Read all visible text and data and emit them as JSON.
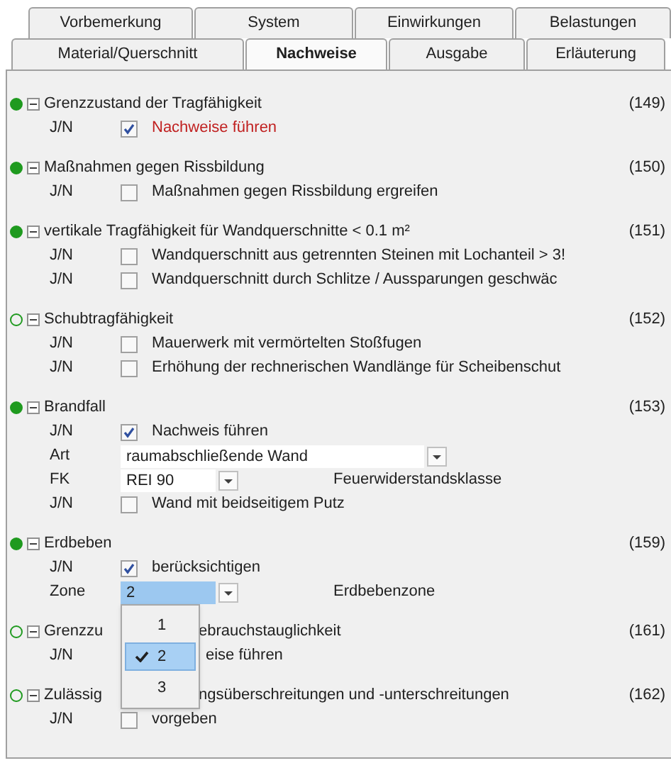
{
  "tabs_top": [
    {
      "label": "Vorbemerkung",
      "selected": false
    },
    {
      "label": "System",
      "selected": false
    },
    {
      "label": "Einwirkungen",
      "selected": false
    },
    {
      "label": "Belastungen",
      "selected": false
    }
  ],
  "tabs_bottom": [
    {
      "label": "Material/Querschnitt",
      "selected": false
    },
    {
      "label": "Nachweise",
      "selected": true
    },
    {
      "label": "Ausgabe",
      "selected": false
    },
    {
      "label": "Erläuterung",
      "selected": false
    }
  ],
  "sections": [
    {
      "title": "Grenzzustand der Tragfähigkeit",
      "number": "(149)",
      "filled": true,
      "expanded": true,
      "rows": [
        {
          "kind": "check",
          "label": "J/N",
          "checked": true,
          "text": "Nachweise führen",
          "emphasized": true
        }
      ]
    },
    {
      "title": "Maßnahmen gegen Rissbildung",
      "number": "(150)",
      "filled": true,
      "expanded": true,
      "rows": [
        {
          "kind": "check",
          "label": "J/N",
          "checked": false,
          "text": "Maßnahmen gegen Rissbildung ergreifen",
          "emphasized": false
        }
      ]
    },
    {
      "title": "vertikale Tragfähigkeit für Wandquerschnitte < 0.1 m²",
      "number": "(151)",
      "filled": true,
      "expanded": true,
      "rows": [
        {
          "kind": "check",
          "label": "J/N",
          "checked": false,
          "text": "Wandquerschnitt aus getrennten Steinen mit Lochanteil > 3!",
          "emphasized": false
        },
        {
          "kind": "check",
          "label": "J/N",
          "checked": false,
          "text": "Wandquerschnitt durch Schlitze / Aussparungen geschwäc",
          "emphasized": false
        }
      ]
    },
    {
      "title": "Schubtragfähigkeit",
      "number": "(152)",
      "filled": false,
      "expanded": true,
      "rows": [
        {
          "kind": "check",
          "label": "J/N",
          "checked": false,
          "text": "Mauerwerk mit vermörtelten Stoßfugen",
          "emphasized": false
        },
        {
          "kind": "check",
          "label": "J/N",
          "checked": false,
          "text": "Erhöhung der rechnerischen Wandlänge für Scheibenschut",
          "emphasized": false
        }
      ]
    },
    {
      "title": "Brandfall",
      "number": "(153)",
      "filled": true,
      "expanded": true,
      "rows": [
        {
          "kind": "check",
          "label": "J/N",
          "checked": true,
          "text": "Nachweis führen",
          "emphasized": false
        },
        {
          "kind": "combo",
          "label": "Art",
          "value": "raumabschließende Wand",
          "focused": false
        },
        {
          "kind": "combo",
          "label": "FK",
          "value": "REI 90",
          "hint": "Feuerwiderstandsklasse",
          "focused": false
        },
        {
          "kind": "check",
          "label": "J/N",
          "checked": false,
          "text": "Wand mit beidseitigem Putz",
          "emphasized": false
        }
      ]
    },
    {
      "title": "Erdbeben",
      "number": "(159)",
      "filled": true,
      "expanded": true,
      "rows": [
        {
          "kind": "check",
          "label": "J/N",
          "checked": true,
          "text": "berücksichtigen",
          "emphasized": false
        },
        {
          "kind": "combo",
          "label": "Zone",
          "value": "2",
          "hint": "Erdbebenzone",
          "focused": true,
          "options": [
            {
              "label": "1",
              "selected": false
            },
            {
              "label": "2",
              "selected": true
            },
            {
              "label": "3",
              "selected": false
            }
          ]
        }
      ]
    },
    {
      "title_parts": [
        "Grenzzu",
        "ebrauchstauglichkeit"
      ],
      "number": "(161)",
      "filled": false,
      "expanded": true,
      "rows": [
        {
          "kind": "check",
          "label": "J/N",
          "text": "eise führen",
          "emphasized": false
        }
      ]
    },
    {
      "title_parts": [
        "Zulässig",
        "ngsüberschreitungen und -unterschreitungen"
      ],
      "number": "(162)",
      "filled": false,
      "expanded": true,
      "rows": [
        {
          "kind": "check",
          "label": "J/N",
          "checked": false,
          "text": "vorgeben",
          "emphasized": false
        }
      ]
    }
  ]
}
